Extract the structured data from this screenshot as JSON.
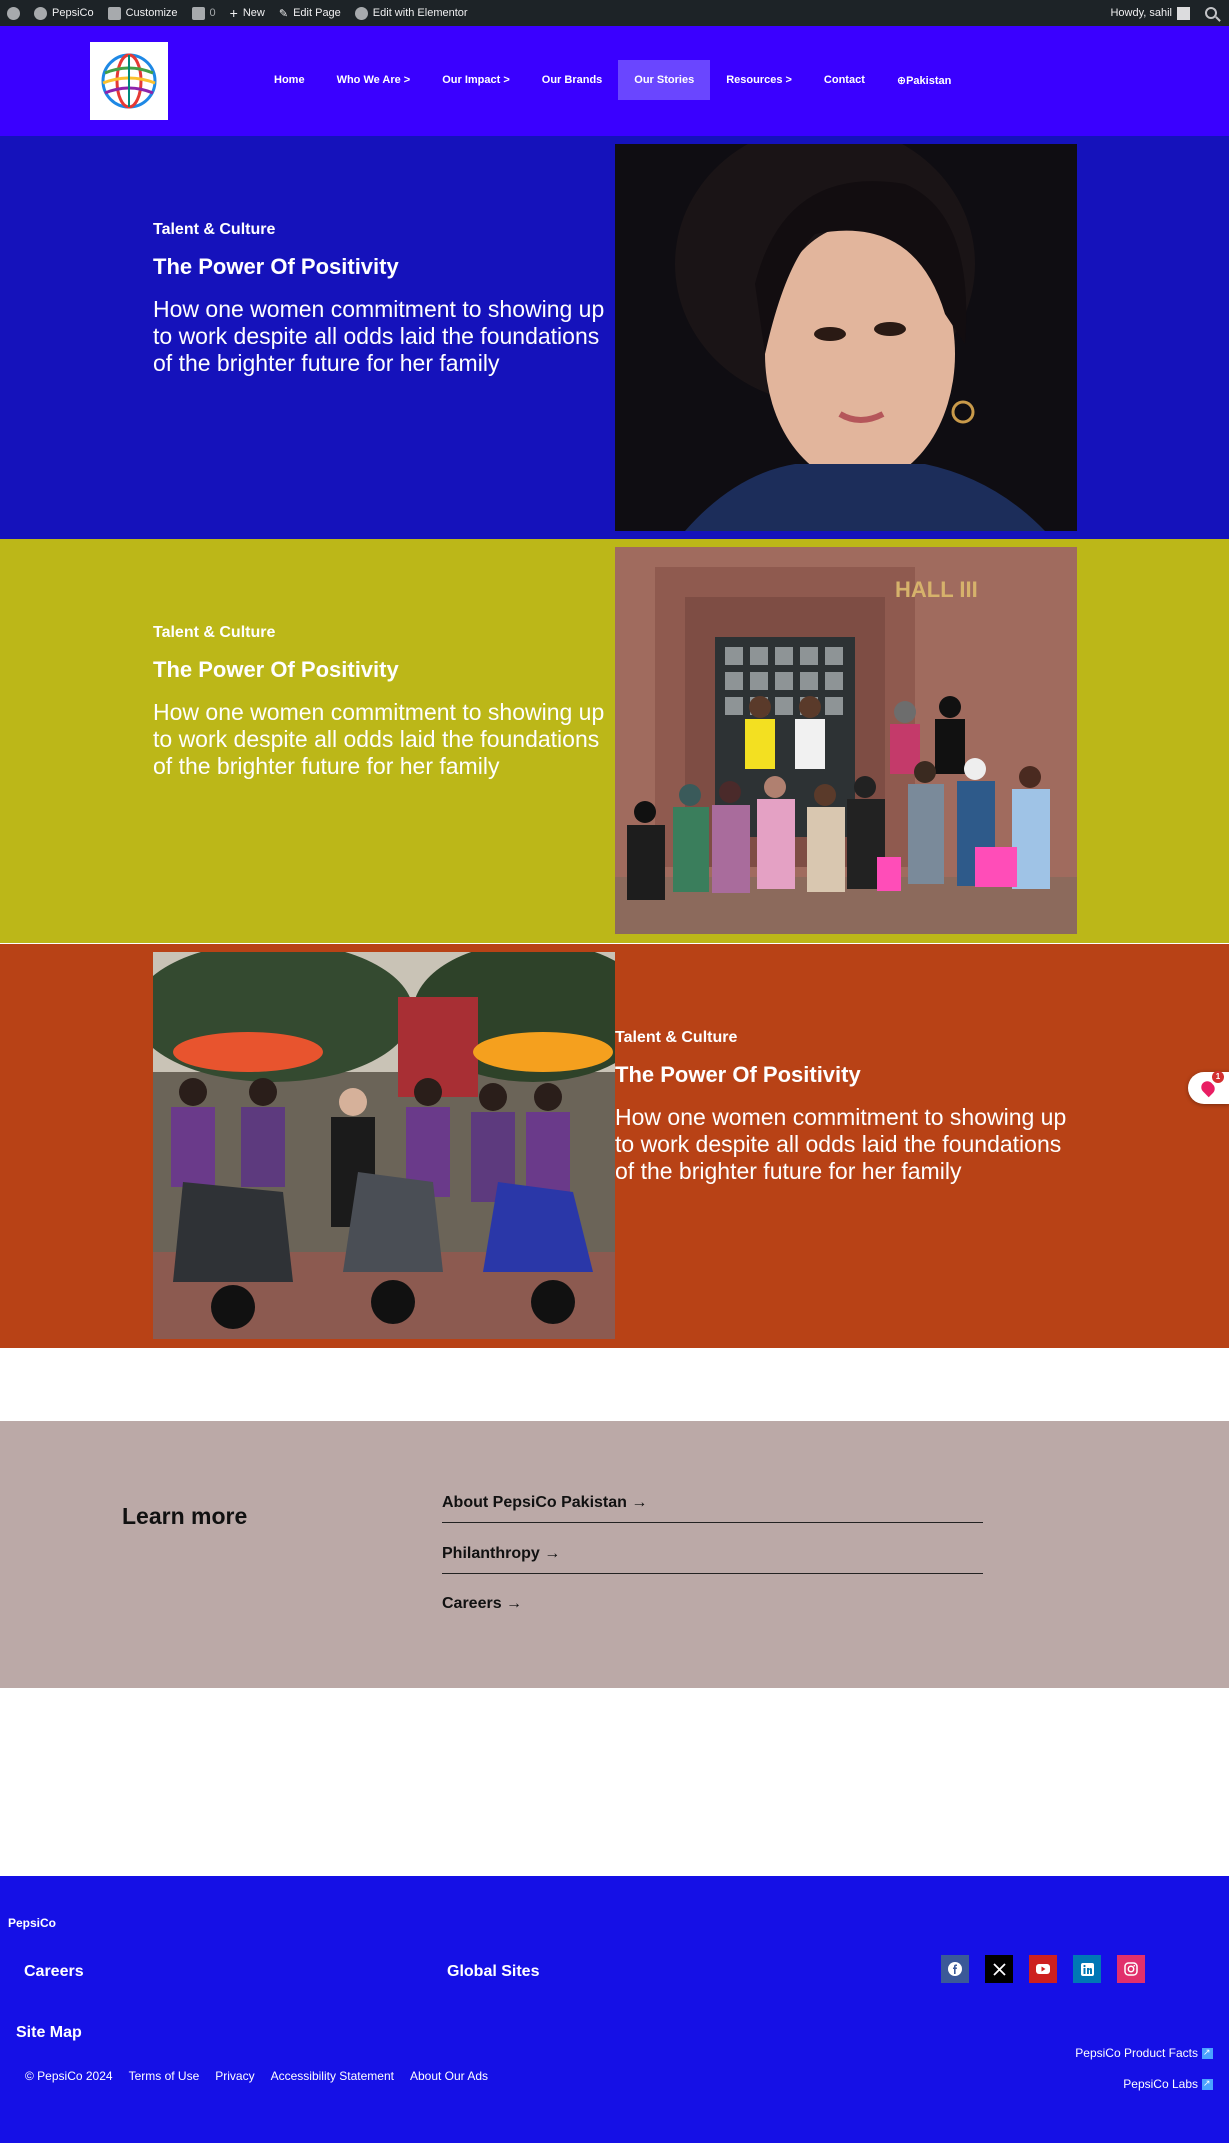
{
  "admin_bar": {
    "site": "PepsiCo",
    "customize": "Customize",
    "comments": "0",
    "new": "New",
    "edit_page": "Edit Page",
    "edit_elementor": "Edit with Elementor",
    "greeting": "Howdy, sahil"
  },
  "nav": {
    "items": [
      {
        "label": "Home"
      },
      {
        "label": "Who We Are >"
      },
      {
        "label": "Our Impact >"
      },
      {
        "label": "Our Brands"
      },
      {
        "label": "Our Stories",
        "active": true
      },
      {
        "label": "Resources >"
      },
      {
        "label": "Contact"
      },
      {
        "label": "⊕Pakistan"
      }
    ]
  },
  "stories": [
    {
      "eyebrow": "Talent & Culture",
      "title": "The Power Of Positivity",
      "desc": "How one women commitment to showing up to work despite all odds laid the foundations of the brighter future for her family",
      "bg": "#1512bb"
    },
    {
      "eyebrow": "Talent & Culture",
      "title": "The Power Of Positivity",
      "desc": "How one women commitment to showing up to work despite all odds laid the foundations of the brighter future for her family",
      "bg": "#bcb718"
    },
    {
      "eyebrow": "Talent & Culture",
      "title": "The Power Of Positivity",
      "desc": "How one women commitment to showing up to work despite all odds laid the foundations of the brighter future for her family",
      "bg": "#b84216"
    }
  ],
  "learn_more": {
    "title": "Learn more",
    "links": [
      {
        "label": "About PepsiCo Pakistan →"
      },
      {
        "label": "Philanthropy →"
      },
      {
        "label": "Careers →"
      }
    ]
  },
  "feedback_badge": "1",
  "footer": {
    "brand": "PepsiCo",
    "careers": "Careers",
    "global_sites": "Global Sites",
    "social": [
      "facebook-icon",
      "x-icon",
      "youtube-icon",
      "linkedin-icon",
      "instagram-icon"
    ],
    "site_map": "Site Map",
    "copyright": "© PepsiCo 2024",
    "links": [
      "Terms of Use",
      "Privacy",
      "Accessibility Statement",
      "About Our Ads"
    ],
    "product_facts": "PepsiCo Product Facts",
    "labs": "PepsiCo Labs"
  },
  "colors": {
    "header": "#3a00ff",
    "footer": "#1510e6",
    "learn_bg": "#bba9a7"
  }
}
